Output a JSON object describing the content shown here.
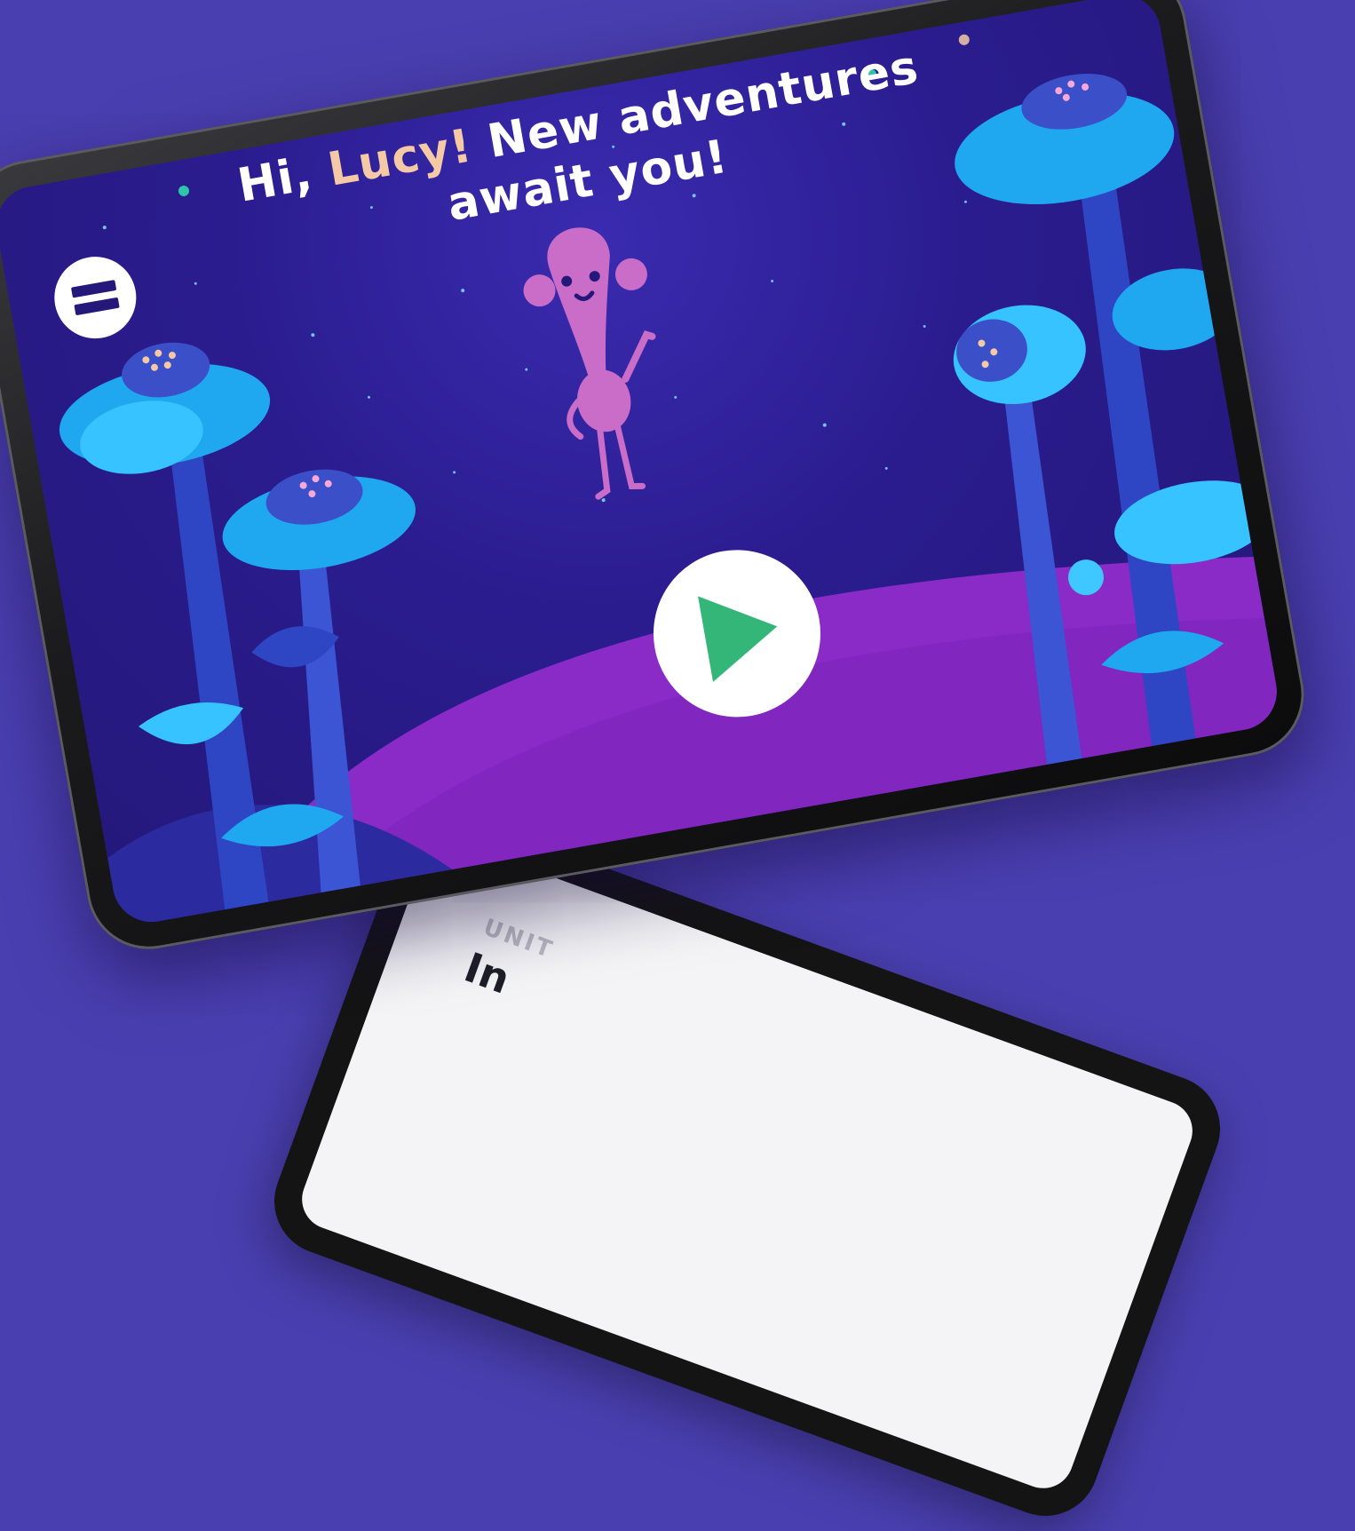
{
  "greeting": {
    "hi": "Hi, ",
    "name": "Lucy!",
    "line1_rest": " New adventures",
    "line2": "await you!"
  },
  "menu": {
    "icon": "menu-icon"
  },
  "play": {
    "icon": "play-icon",
    "color": "#35b679"
  },
  "second_screen": {
    "unit_label": "UNIT",
    "title_partial": "In"
  },
  "colors": {
    "background": "#4a3fb0",
    "sky": "#2a1c8e",
    "hill": "#8a2bc8",
    "flower_light": "#1fa8f0",
    "flower_dark": "#2f46c4",
    "character": "#c96dc9",
    "name_accent": "#f6c9a6"
  }
}
